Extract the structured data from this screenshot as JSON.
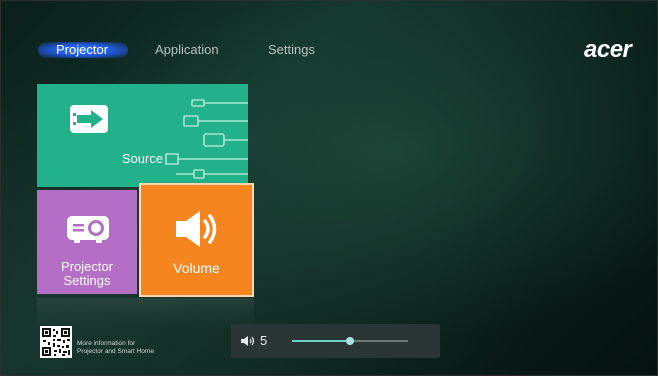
{
  "nav": {
    "tabs": [
      {
        "label": "Projector",
        "active": true
      },
      {
        "label": "Application",
        "active": false
      },
      {
        "label": "Settings",
        "active": false
      }
    ]
  },
  "brand": {
    "logo_text": "acer"
  },
  "tiles": {
    "source": {
      "label": "Source",
      "color": "#23b189"
    },
    "projector_settings": {
      "label_line1": "Projector",
      "label_line2": "Settings",
      "color": "#b46ec6"
    },
    "volume": {
      "label": "Volume",
      "color": "#f5861f"
    }
  },
  "footer": {
    "info_line1": "More information for",
    "info_line2": "Projector and Smart Home"
  },
  "volume_control": {
    "value": "5",
    "level_fraction": 0.5
  },
  "colors": {
    "nav_active_glow": "#2f7cff"
  }
}
